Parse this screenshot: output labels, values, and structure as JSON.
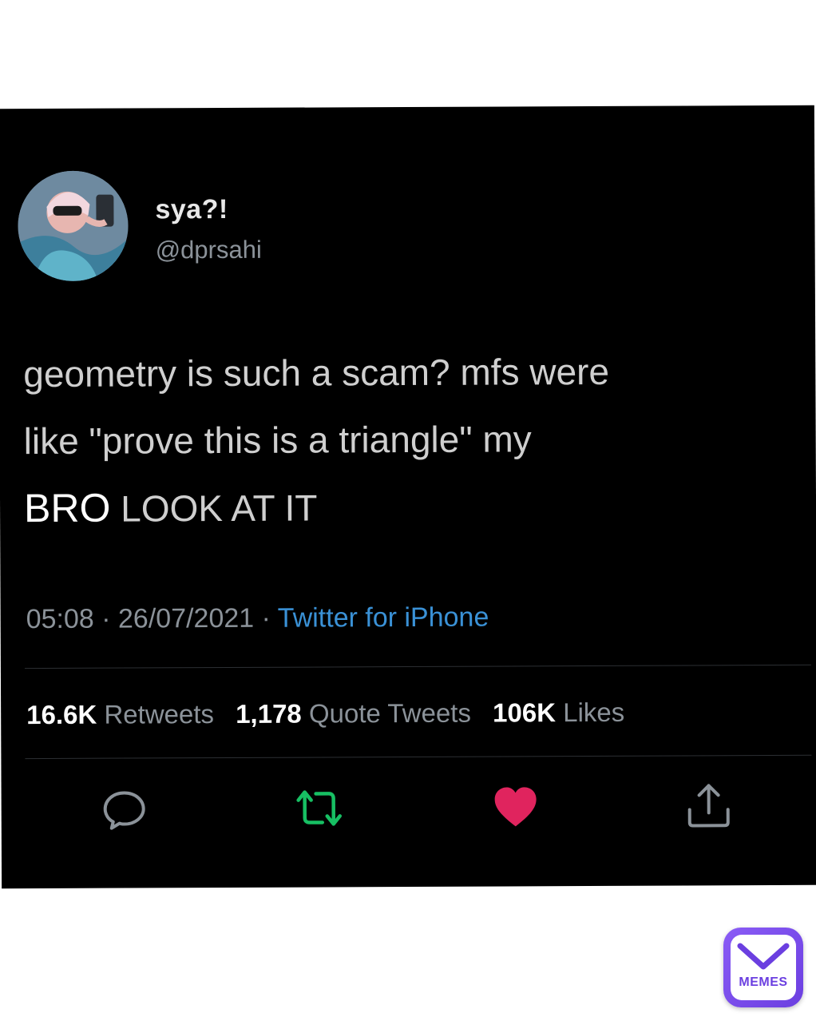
{
  "tweet": {
    "display_name": "sya?!",
    "handle": "@dprsahi",
    "text_line_1": "geometry is such a scam? mfs were",
    "text_line_2": "like \"prove this is a triangle\" my",
    "text_bro": "BRO",
    "text_look": "LOOK AT IT",
    "time": "05:08",
    "separator_1": " · ",
    "date": "26/07/2021",
    "separator_2": " · ",
    "source": "Twitter for iPhone",
    "source_color": "#3a91d6"
  },
  "stats": {
    "retweets_count": "16.6K",
    "retweets_label": "Retweets",
    "quotes_count": "1,178",
    "quotes_label": "Quote Tweets",
    "likes_count": "106K",
    "likes_label": "Likes"
  },
  "actions": [
    {
      "icon": "reply-icon",
      "color": "#8b9299"
    },
    {
      "icon": "retweet-icon",
      "color": "#17bf63"
    },
    {
      "icon": "heart-icon",
      "color": "#e0245e"
    },
    {
      "icon": "share-icon",
      "color": "#8b9299"
    }
  ],
  "watermark": {
    "label": "MEMES",
    "color": "#6b3fe0",
    "icon": "memes-logo-icon"
  }
}
